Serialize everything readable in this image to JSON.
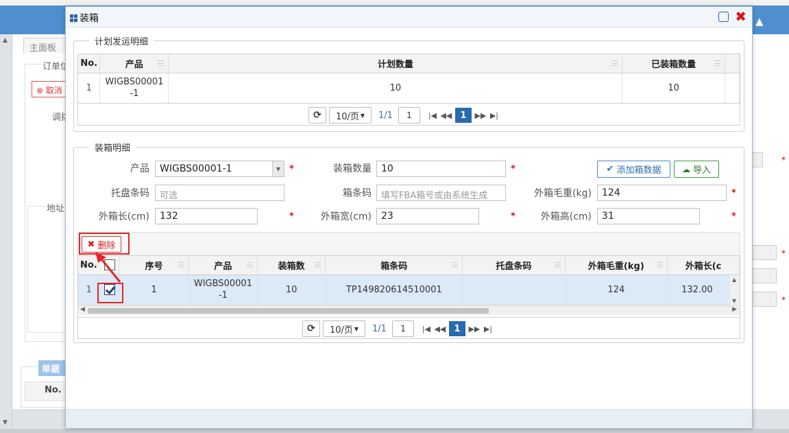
{
  "background": {
    "home_tab": "主面板",
    "order_legend": "订单信",
    "cancel_label": "取消",
    "adjust_label": "调拨",
    "address_label": "地址",
    "doc_section": "单据",
    "no_header": "No."
  },
  "dialog": {
    "title": "装箱"
  },
  "plan_section": {
    "legend": "计划发运明细",
    "columns": [
      "No.",
      "产品",
      "计划数量",
      "已装箱数量"
    ],
    "rows": [
      {
        "no": "1",
        "product": "WIGBS00001-1",
        "product_line1": "WIGBS00001",
        "product_line2": "-1",
        "plan_qty": "10",
        "packed_qty": "10"
      }
    ],
    "pager": {
      "page_size": "10/页",
      "page_info": "1/1",
      "page_input": "1",
      "current_page": "1"
    }
  },
  "packing_section": {
    "legend": "装箱明细",
    "form": {
      "product_label": "产品",
      "product_value": "WIGBS00001-1",
      "qty_label": "装箱数量",
      "qty_value": "10",
      "add_button": "添加箱数据",
      "import_button": "导入",
      "pallet_label": "托盘条码",
      "pallet_placeholder": "可选",
      "box_code_label": "箱条码",
      "box_code_placeholder": "填写FBA箱号或由系统生成",
      "gross_weight_label": "外箱毛重(kg)",
      "gross_weight_value": "124",
      "length_label": "外箱长(cm)",
      "length_value": "132",
      "width_label": "外箱宽(cm)",
      "width_value": "23",
      "height_label": "外箱高(cm)",
      "height_value": "31",
      "required_mark": "*"
    },
    "delete_button": "删除",
    "columns": [
      "No.",
      "序号",
      "产品",
      "装箱数",
      "箱条码",
      "托盘条码",
      "外箱毛重(kg)",
      "外箱长(c"
    ],
    "rows": [
      {
        "no": "1",
        "checked": true,
        "seq": "1",
        "product_line1": "WIGBS00001",
        "product_line2": "-1",
        "box_qty": "10",
        "box_code": "TP149820614510001",
        "pallet_code": "",
        "gross_weight": "124",
        "length": "132.00"
      }
    ],
    "pager": {
      "page_size": "10/页",
      "page_info": "1/1",
      "page_input": "1",
      "current_page": "1"
    }
  },
  "colors": {
    "accent": "#286aaf",
    "danger": "#e02828",
    "success": "#3f9a3f",
    "selected_row": "#dce9f7"
  }
}
